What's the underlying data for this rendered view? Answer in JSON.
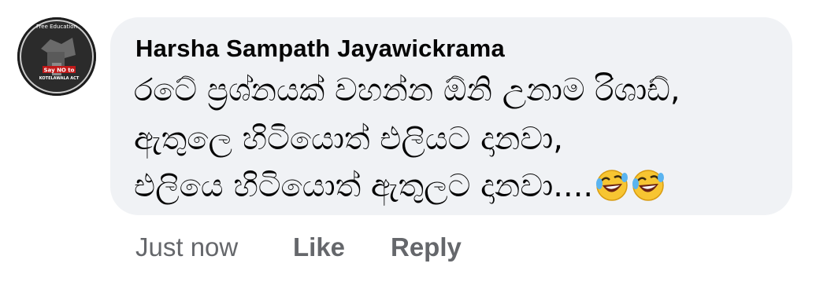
{
  "comment": {
    "avatar": {
      "badge_text_top": "Free Education",
      "badge_text_center": "Say NO to",
      "badge_text_bottom": "KOTELAWALA ACT"
    },
    "author": "Harsha Sampath Jayawickrama",
    "lines": [
      "රටේ ප්‍රශ්නයක් වහන්න ඕනි උනාම රිශාඩ්,",
      "ඇතුලෙ හිටියොත් එලියට දානවා,",
      "එලියෙ හිටියොත් ඇතුලට දානවා...."
    ],
    "emoji": [
      "rolling-on-floor-laughing-icon",
      "rolling-on-floor-laughing-icon"
    ]
  },
  "actions": {
    "timestamp": "Just now",
    "like_label": "Like",
    "reply_label": "Reply"
  },
  "colors": {
    "bubble_bg": "#f0f2f5",
    "text": "#050505",
    "meta": "#65676b",
    "emoji_face": "#f7c532"
  }
}
